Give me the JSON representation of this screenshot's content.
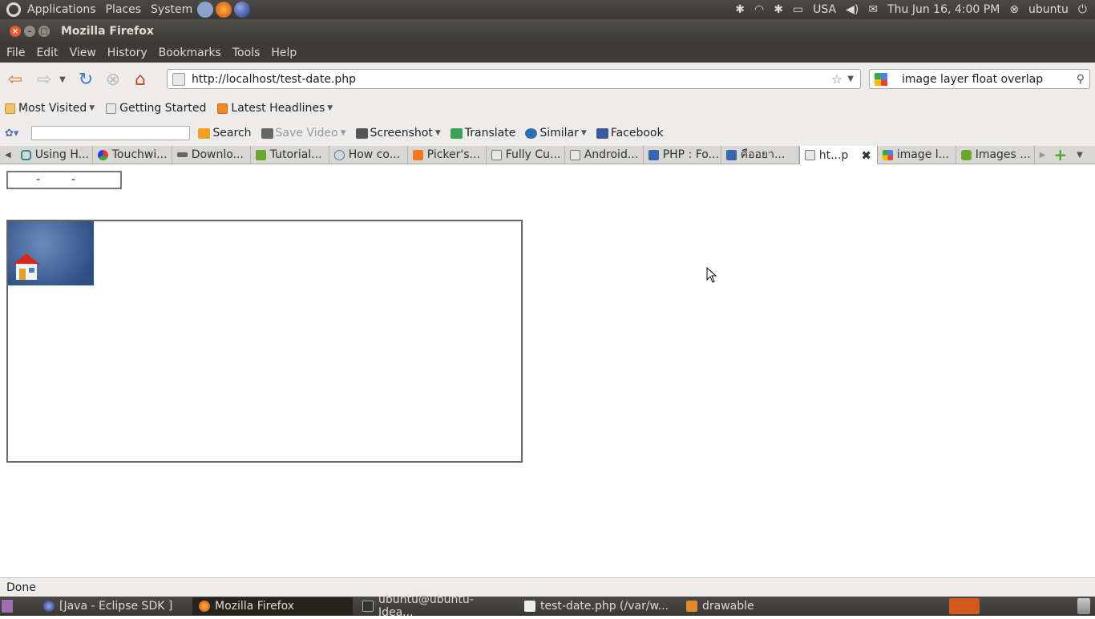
{
  "top_panel": {
    "menus": [
      "Applications",
      "Places",
      "System"
    ],
    "keyboard_layout": "USA",
    "datetime": "Thu Jun 16,  4:00 PM",
    "user": "ubuntu"
  },
  "window": {
    "title": "Mozilla Firefox"
  },
  "menubar": {
    "items": [
      "File",
      "Edit",
      "View",
      "History",
      "Bookmarks",
      "Tools",
      "Help"
    ]
  },
  "navbar": {
    "url": "http://localhost/test-date.php",
    "search_query": "image layer float overlap"
  },
  "bookmarks": {
    "items": [
      "Most Visited",
      "Getting Started",
      "Latest Headlines"
    ]
  },
  "addon_toolbar": {
    "items": [
      "Search",
      "Save Video",
      "Screenshot",
      "Translate",
      "Similar",
      "Facebook"
    ]
  },
  "tabs": [
    "Using H...",
    "Touchwi...",
    "Downlo...",
    "Tutorial...",
    "How co...",
    "Picker's...",
    "Fully Cu...",
    "Android...",
    "PHP : Fo...",
    "คืออยา...",
    "ht...p",
    "image l...",
    "Images ..."
  ],
  "page": {
    "date_sep1": "-",
    "date_sep2": "-"
  },
  "statusbar": {
    "text": "Done"
  },
  "taskbar": {
    "items": [
      "[Java - Eclipse SDK ]",
      "Mozilla Firefox",
      "ubuntu@ubuntu-Idea...",
      "test-date.php (/var/w...",
      "drawable"
    ]
  },
  "colors": {
    "panel_bg": "#3c3b37",
    "close_button": "#e55b2e",
    "toolbar_bg": "#edeceb"
  }
}
